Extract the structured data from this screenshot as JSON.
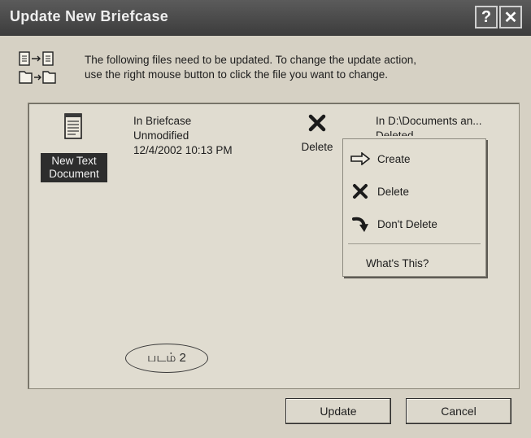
{
  "window": {
    "title": "Update New Briefcase",
    "help_label": "?",
    "close_label": "✕"
  },
  "intro": {
    "line1": "The following files need to be updated. To change the update action,",
    "line2": "use the right mouse button to click the file you want to change."
  },
  "file": {
    "name_line1": "New Text",
    "name_line2": "Document",
    "location": "In Briefcase",
    "status": "Unmodified",
    "timestamp": "12/4/2002 10:13 PM",
    "action": "Delete",
    "target_location": "In D:\\Documents an...",
    "target_status": "Deleted"
  },
  "context_menu": {
    "items": [
      {
        "label": "Create",
        "icon": "arrow-right-icon"
      },
      {
        "label": "Delete",
        "icon": "delete-x-icon"
      },
      {
        "label": "Don't Delete",
        "icon": "curved-arrow-icon"
      }
    ],
    "whats_this": "What's This?"
  },
  "caption": "படம் 2",
  "buttons": {
    "update": "Update",
    "cancel": "Cancel"
  }
}
